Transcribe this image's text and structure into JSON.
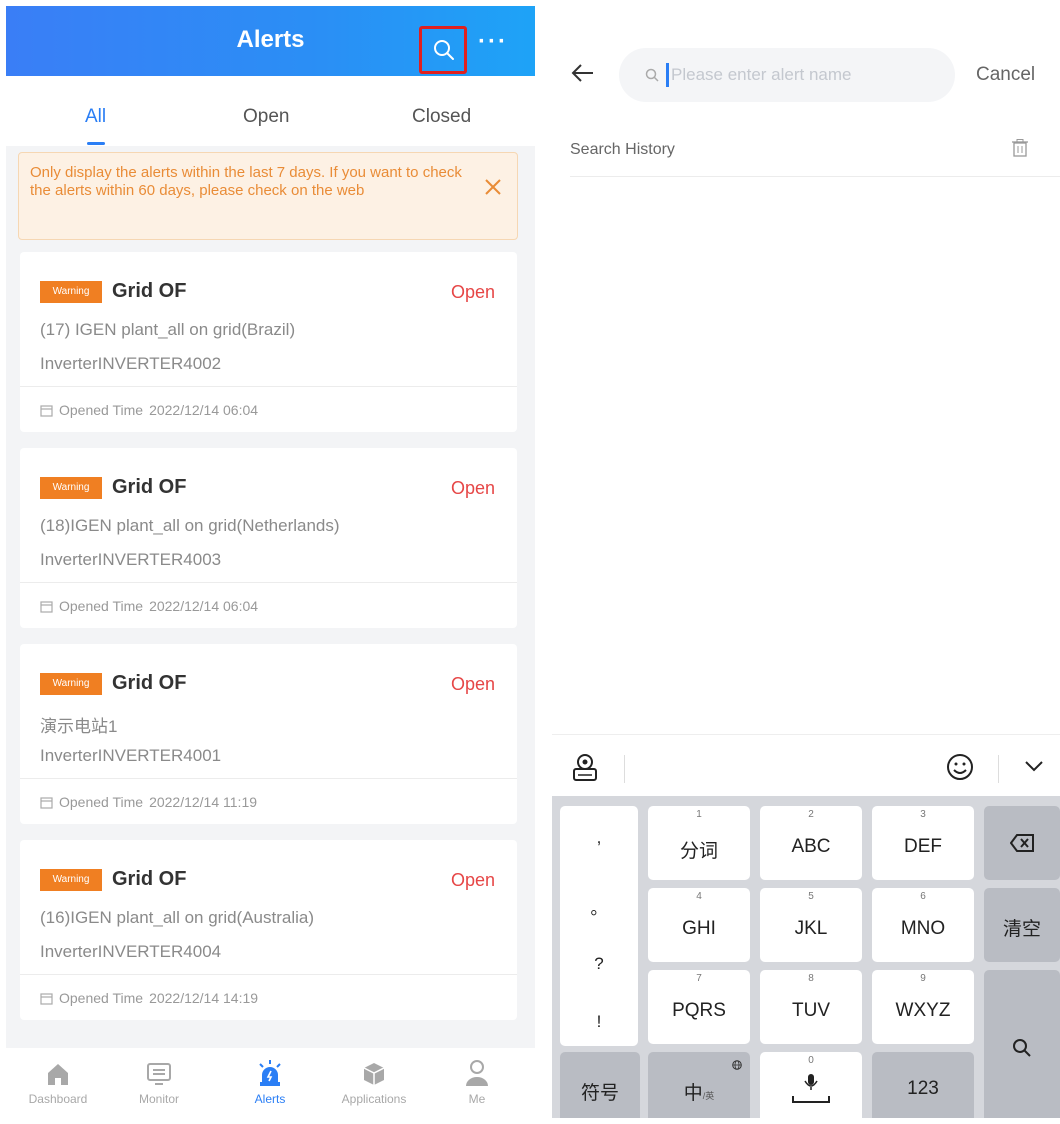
{
  "left": {
    "header": {
      "title": "Alerts",
      "more": "···"
    },
    "tabs": [
      {
        "label": "All"
      },
      {
        "label": "Open"
      },
      {
        "label": "Closed"
      }
    ],
    "notice": {
      "text": "Only display the alerts within the last 7 days. If you want to check the alerts within 60 days, please check on the web"
    },
    "alerts": [
      {
        "badge": "Warning",
        "title": "Grid OF",
        "status": "Open",
        "plant": "(17) IGEN plant_all on grid(Brazil)",
        "device": "InverterINVERTER4002",
        "time_label": "Opened Time",
        "time": "2022/12/14 06:04"
      },
      {
        "badge": "Warning",
        "title": "Grid OF",
        "status": "Open",
        "plant": "(18)IGEN plant_all on grid(Netherlands)",
        "device": "InverterINVERTER4003",
        "time_label": "Opened Time",
        "time": "2022/12/14 06:04"
      },
      {
        "badge": "Warning",
        "title": "Grid OF",
        "status": "Open",
        "plant": "演示电站1",
        "device": "InverterINVERTER4001",
        "time_label": "Opened Time",
        "time": "2022/12/14 11:19"
      },
      {
        "badge": "Warning",
        "title": "Grid OF",
        "status": "Open",
        "plant": "(16)IGEN plant_all on grid(Australia)",
        "device": "InverterINVERTER4004",
        "time_label": "Opened Time",
        "time": "2022/12/14 14:19"
      }
    ],
    "bottom_nav": [
      {
        "label": "Dashboard",
        "icon": "home-icon"
      },
      {
        "label": "Monitor",
        "icon": "monitor-icon"
      },
      {
        "label": "Alerts",
        "icon": "alert-siren-icon"
      },
      {
        "label": "Applications",
        "icon": "cube-icon"
      },
      {
        "label": "Me",
        "icon": "user-icon"
      }
    ]
  },
  "right": {
    "search": {
      "placeholder": "Please enter alert name",
      "value": ""
    },
    "cancel": "Cancel",
    "history_label": "Search History",
    "keyboard": {
      "punct": [
        ",",
        "。",
        "?",
        "!"
      ],
      "rows": [
        [
          {
            "num": "1",
            "label": "分词"
          },
          {
            "num": "2",
            "label": "ABC"
          },
          {
            "num": "3",
            "label": "DEF"
          }
        ],
        [
          {
            "num": "4",
            "label": "GHI"
          },
          {
            "num": "5",
            "label": "JKL"
          },
          {
            "num": "6",
            "label": "MNO"
          }
        ],
        [
          {
            "num": "7",
            "label": "PQRS"
          },
          {
            "num": "8",
            "label": "TUV"
          },
          {
            "num": "9",
            "label": "WXYZ"
          }
        ]
      ],
      "clear": "清空",
      "symbols": "符号",
      "chinese": "中",
      "chinese_sub": "/英",
      "space_num": "0",
      "numbers": "123"
    }
  },
  "colors": {
    "accent": "#2a7ef5",
    "warning": "#f07f22",
    "open": "#e64646",
    "highlight": "#e0201f"
  }
}
